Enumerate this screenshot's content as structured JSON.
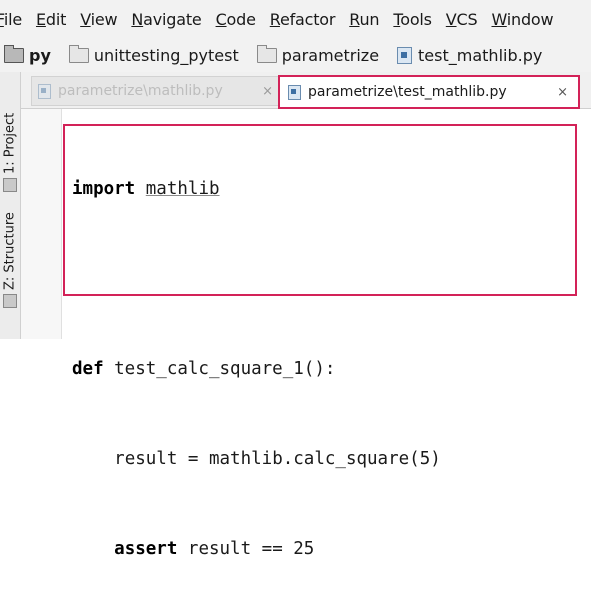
{
  "menubar": {
    "items": [
      {
        "label": "File"
      },
      {
        "label": "Edit"
      },
      {
        "label": "View"
      },
      {
        "label": "Navigate"
      },
      {
        "label": "Code"
      },
      {
        "label": "Refactor"
      },
      {
        "label": "Run"
      },
      {
        "label": "Tools"
      },
      {
        "label": "VCS"
      },
      {
        "label": "Window"
      }
    ]
  },
  "breadcrumb": {
    "items": [
      {
        "label": "py",
        "icon": "folder-icon"
      },
      {
        "label": "unittesting_pytest",
        "icon": "folder-icon"
      },
      {
        "label": "parametrize",
        "icon": "folder-icon"
      },
      {
        "label": "test_mathlib.py",
        "icon": "python-file-icon"
      }
    ]
  },
  "toolstrip": {
    "project_label": "1: Project",
    "structure_label": "Z: Structure"
  },
  "tabs": [
    {
      "label": "parametrize\\mathlib.py",
      "close": "×",
      "active": false
    },
    {
      "label": "parametrize\\test_mathlib.py",
      "close": "×",
      "active": true
    }
  ],
  "editor": {
    "lines": [
      {
        "kw": "import",
        "rest": " ",
        "mod": "mathlib"
      },
      {
        "text": ""
      },
      {
        "kw": "def",
        "rest": " test_calc_square_1():"
      },
      {
        "indent": "    ",
        "text": "result = mathlib.calc_square(5)"
      },
      {
        "indent": "    ",
        "kw": "assert",
        "rest": " result == 25"
      }
    ]
  },
  "colors": {
    "highlight": "#d32258",
    "keyword": "#000080",
    "menubar_bg": "#f2f2f2"
  }
}
